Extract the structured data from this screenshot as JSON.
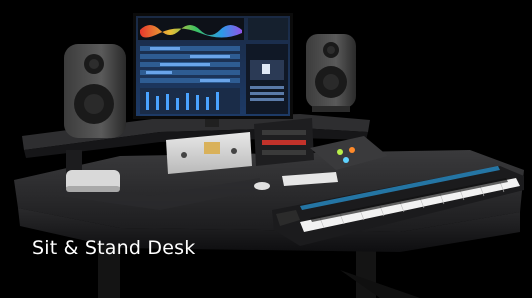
{
  "caption": "Sit & Stand Desk"
}
